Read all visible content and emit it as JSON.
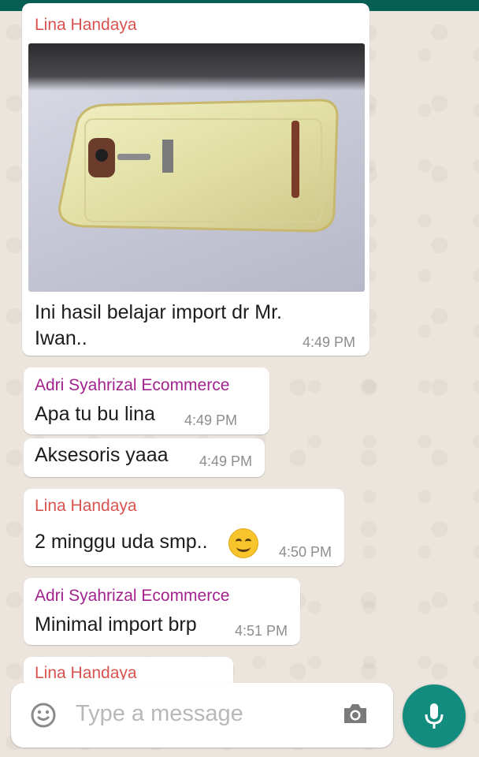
{
  "colors": {
    "header": "#075e54",
    "accent": "#128c7e",
    "lina": "#d9534f",
    "adri": "#a2238e"
  },
  "messages": [
    {
      "sender": "Lina Handaya",
      "text_line1": "Ini hasil belajar import dr Mr.",
      "text_line2": "Iwan..",
      "time": "4:49 PM",
      "has_image": true,
      "image_subject": "gold mirrored smartphone case"
    },
    {
      "sender": "Adri Syahrizal Ecommerce",
      "text": "Apa tu bu lina",
      "time": "4:49 PM"
    },
    {
      "text": "Aksesoris yaaa",
      "time": "4:49 PM"
    },
    {
      "sender": "Lina Handaya",
      "text": "2 minggu uda smp..",
      "time": "4:50 PM",
      "emoji": "smiling-face"
    },
    {
      "sender": "Adri Syahrizal Ecommerce",
      "text": "Minimal import brp",
      "time": "4:51 PM"
    },
    {
      "sender": "Lina Handaya"
    }
  ],
  "composer": {
    "placeholder": "Type a message",
    "left_icon": "emoji-icon",
    "camera_icon": "camera-icon",
    "send_icon": "mic-icon"
  }
}
